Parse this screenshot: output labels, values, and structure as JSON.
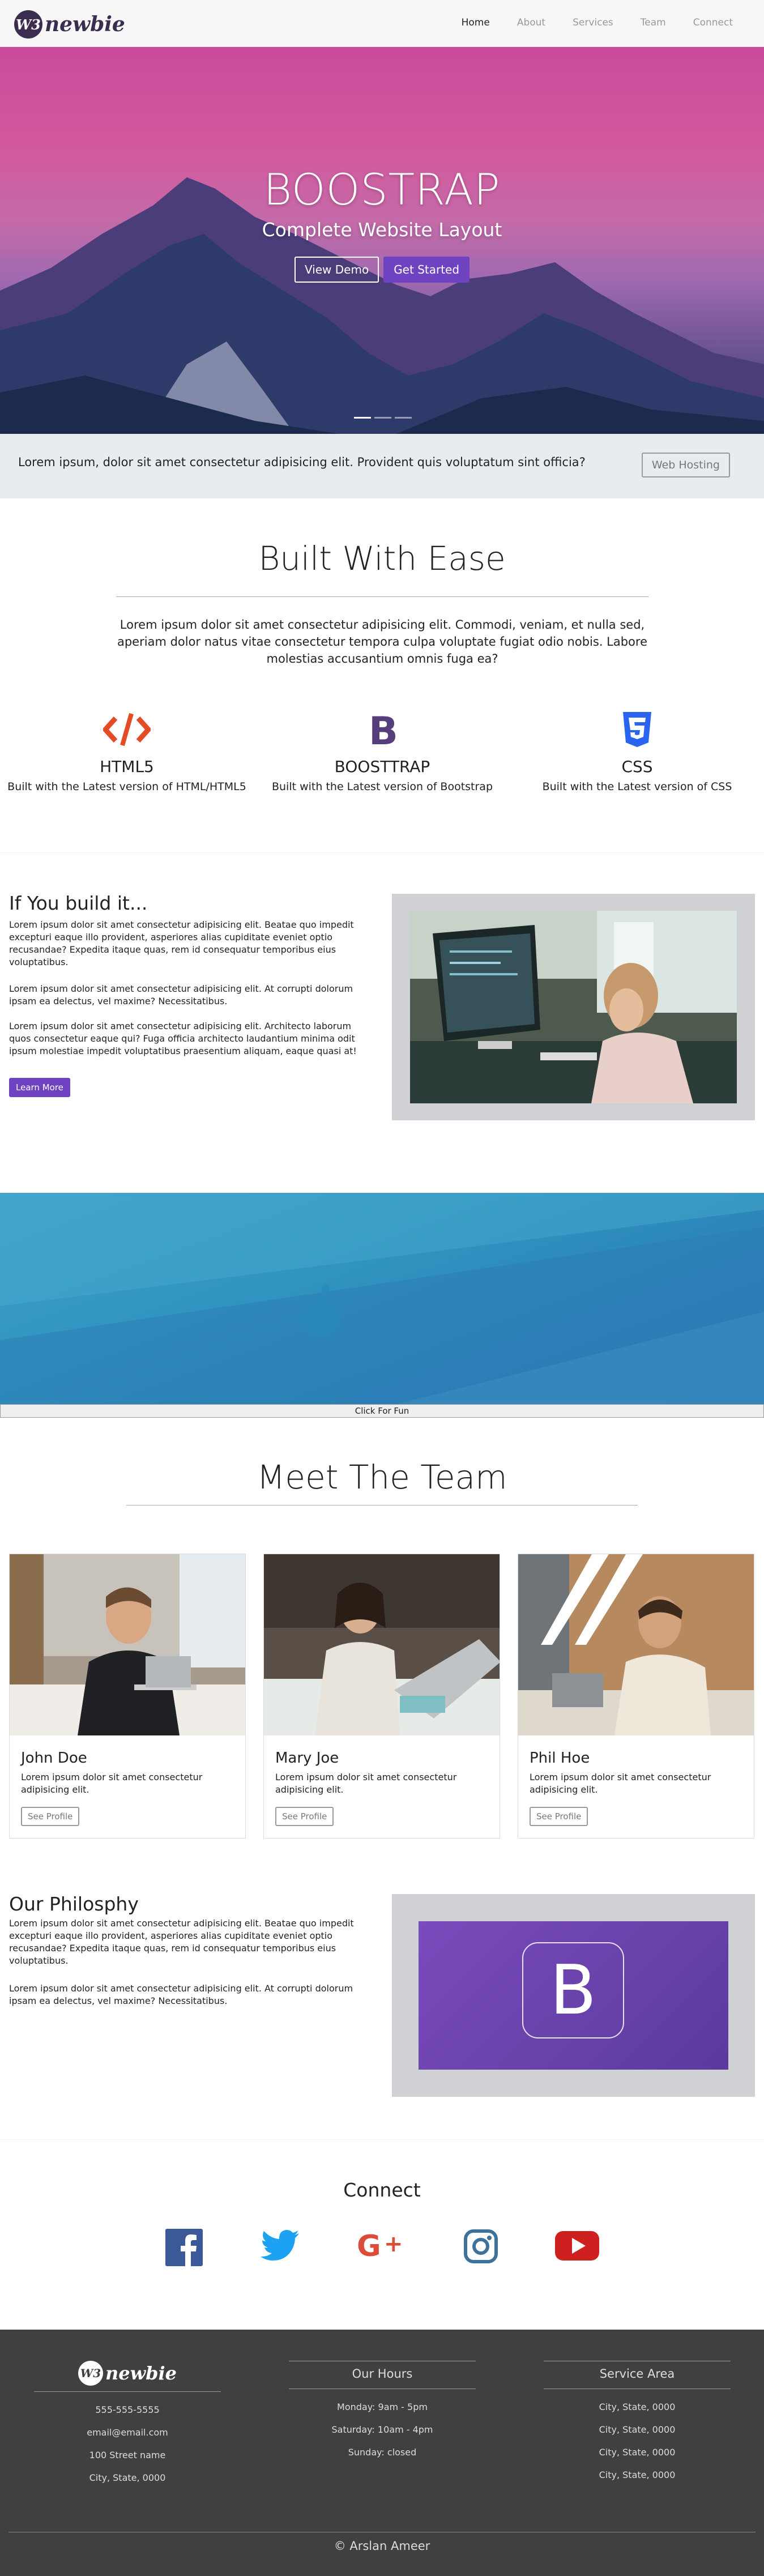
{
  "nav": {
    "logo_badge": "W3",
    "logo_text": "newbie",
    "links": [
      "Home",
      "About",
      "Services",
      "Team",
      "Connect"
    ]
  },
  "hero": {
    "title": "BOOSTRAP",
    "subtitle": "Complete Website Layout",
    "view_demo": "View Demo",
    "get_started": "Get Started"
  },
  "jumbotron": {
    "text": "Lorem ipsum, dolor sit amet consectetur adipisicing elit. Provident quis voluptatum sint officia?",
    "button": "Web Hosting"
  },
  "built": {
    "title": "Built With Ease",
    "lead": "Lorem ipsum dolor sit amet consectetur adipisicing elit. Commodi, veniam, et nulla sed, aperiam dolor natus vitae consectetur tempora culpa voluptate fugiat odio nobis. Labore molestias accusantium omnis fuga ea?",
    "features": [
      {
        "icon": "html5-code-icon",
        "title": "HTML5",
        "desc": "Built with the Latest version of HTML/HTML5",
        "color": "#e34c26"
      },
      {
        "icon": "bootstrap-icon",
        "title": "BOOSTTRAP",
        "desc": "Built with the Latest version of Bootstrap",
        "color": "#563d7c"
      },
      {
        "icon": "css3-icon",
        "title": "CSS",
        "desc": "Built with the Latest version of CSS",
        "color": "#2965f1"
      }
    ]
  },
  "build": {
    "title": "If You build it...",
    "p1": "Lorem ipsum dolor sit amet consectetur adipisicing elit. Beatae quo impedit excepturi eaque illo provident, asperiores alias cupiditate eveniet optio recusandae? Expedita itaque quas, rem id consequatur temporibus eius voluptatibus.",
    "p2": "Lorem ipsum dolor sit amet consectetur adipisicing elit. At corrupti dolorum ipsam ea delectus, vel maxime? Necessitatibus.",
    "p3": "Lorem ipsum dolor sit amet consectetur adipisicing elit. Architecto laborum quos consectetur eaque qui? Fuga officia architecto laudantium minima odit ipsum molestiae impedit voluptatibus praesentium aliquam, eaque quasi at!",
    "button": "Learn More"
  },
  "fixed": {
    "button": "Click For Fun"
  },
  "team": {
    "title": "Meet The Team",
    "members": [
      {
        "name": "John Doe",
        "desc": "Lorem ipsum dolor sit amet consectetur adipisicing elit.",
        "button": "See Profile"
      },
      {
        "name": "Mary Joe",
        "desc": "Lorem ipsum dolor sit amet consectetur adipisicing elit.",
        "button": "See Profile"
      },
      {
        "name": "Phil Hoe",
        "desc": "Lorem ipsum dolor sit amet consectetur adipisicing elit.",
        "button": "See Profile"
      }
    ]
  },
  "philosophy": {
    "title": "Our Philosphy",
    "p1": "Lorem ipsum dolor sit amet consectetur adipisicing elit. Beatae quo impedit excepturi eaque illo provident, asperiores alias cupiditate eveniet optio recusandae? Expedita itaque quas, rem id consequatur temporibus eius voluptatibus.",
    "p2": "Lorem ipsum dolor sit amet consectetur adipisicing elit. At corrupti dolorum ipsam ea delectus, vel maxime? Necessitatibus.",
    "logo_letter": "B"
  },
  "connect": {
    "title": "Connect",
    "icons": [
      "facebook-icon",
      "twitter-icon",
      "google-plus-icon",
      "instagram-icon",
      "youtube-icon"
    ]
  },
  "footer": {
    "contact": [
      "555-555-5555",
      "email@email.com",
      "100 Street name",
      "City, State, 0000"
    ],
    "hours_title": "Our Hours",
    "hours": [
      "Monday: 9am - 5pm",
      "Saturday: 10am - 4pm",
      "Sunday: closed"
    ],
    "service_title": "Service Area",
    "service": [
      "City, State, 0000",
      "City, State, 0000",
      "City, State, 0000",
      "City, State, 0000"
    ],
    "copyright": "© Arslan Ameer"
  },
  "colors": {
    "accent": "#6f42c1",
    "footer_bg": "#404040",
    "fixed_bg": "#3194c0"
  }
}
